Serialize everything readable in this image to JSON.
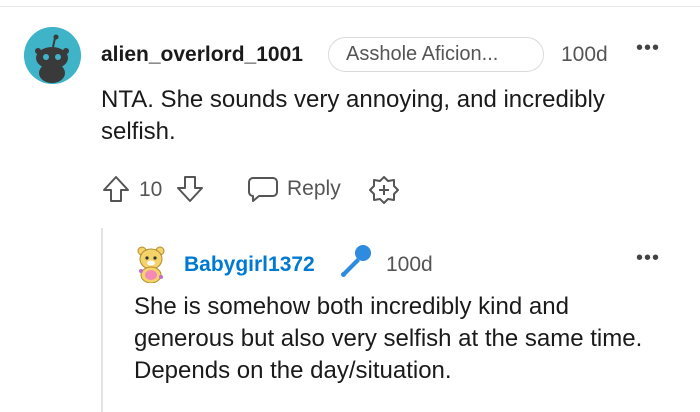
{
  "comment1": {
    "author": "alien_overlord_1001",
    "flair": "Asshole Aficion...",
    "time": "100d",
    "more": "•••",
    "body": "NTA. She sounds very annoying, and incredibly selfish.",
    "score": "10",
    "reply_label": "Reply"
  },
  "comment2": {
    "author": "Babygirl1372",
    "time": "100d",
    "more": "•••",
    "body": "She is somehow both incredibly kind and generous but also very selfish at the same time. Depends on the day/situation."
  },
  "colors": {
    "username_link": "#0079d3",
    "mic_icon": "#2e8be0",
    "avatar_bg": "#3fb4c9"
  }
}
